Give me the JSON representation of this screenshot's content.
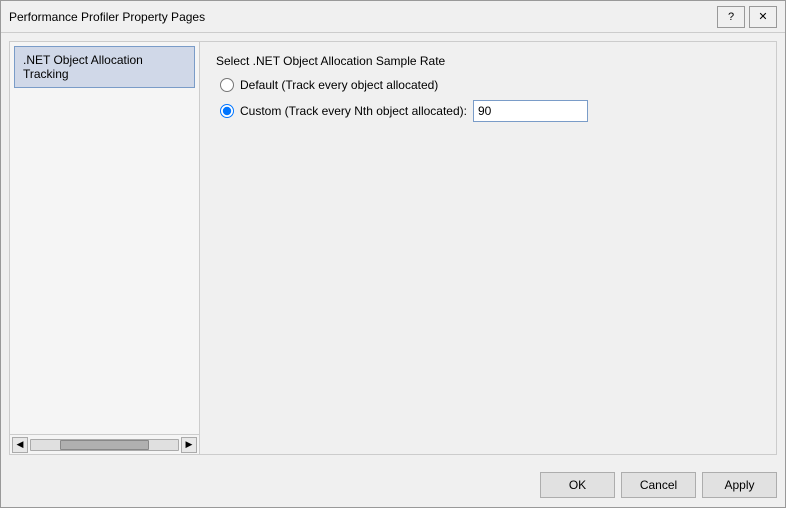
{
  "window": {
    "title": "Performance Profiler Property Pages",
    "help_btn": "?",
    "close_btn": "✕"
  },
  "sidebar": {
    "items": [
      {
        "label": ".NET Object Allocation Tracking",
        "selected": true
      }
    ],
    "scroll_left_arrow": "◀",
    "scroll_right_arrow": "▶"
  },
  "right_panel": {
    "section_label": "Select .NET Object Allocation Sample Rate",
    "radio_options": [
      {
        "id": "radio-default",
        "label": "Default (Track every object allocated)",
        "checked": false
      },
      {
        "id": "radio-custom",
        "label": "Custom (Track every Nth object allocated):",
        "checked": true,
        "input_value": "90"
      }
    ]
  },
  "footer": {
    "ok_label": "OK",
    "cancel_label": "Cancel",
    "apply_label": "Apply"
  }
}
